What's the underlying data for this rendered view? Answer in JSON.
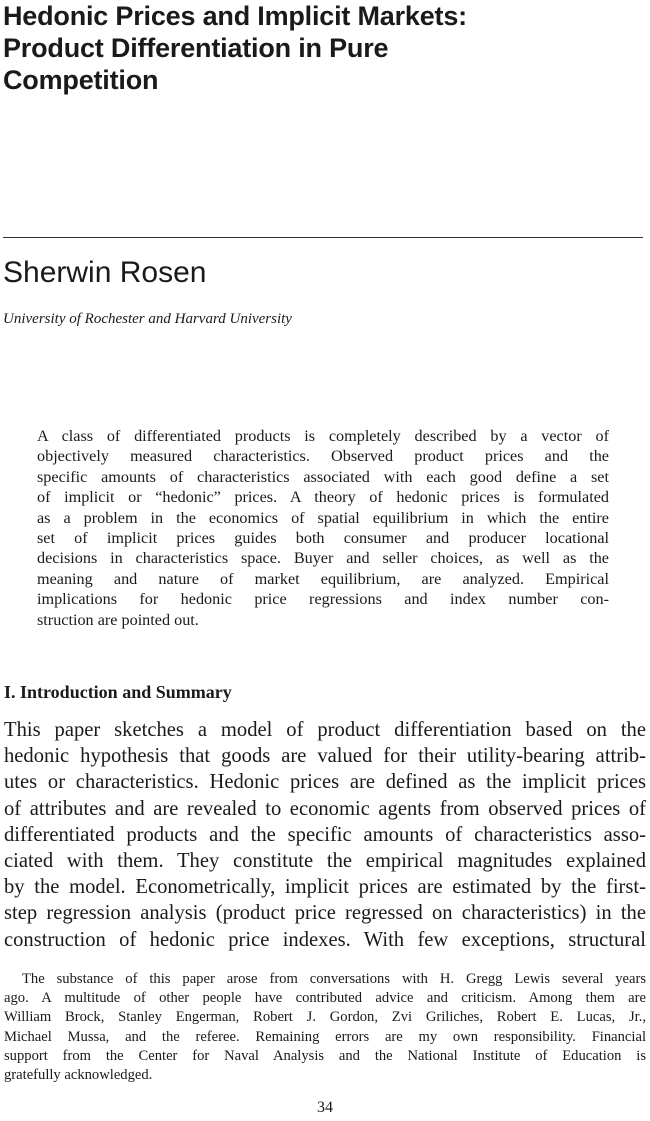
{
  "article": {
    "title_lines": [
      "Hedonic Prices and Implicit Markets:",
      "Product Differentiation in Pure",
      "Competition"
    ],
    "author": "Sherwin Rosen",
    "affiliation": "University of Rochester and Harvard University"
  },
  "abstract": {
    "lines": [
      "A class of differentiated products is completely described by a vector of",
      "objectively measured characteristics. Observed product prices and the",
      "specific amounts of characteristics associated with each good define a set",
      "of implicit or “hedonic” prices. A theory of hedonic prices is formulated",
      "as a problem in the economics of spatial equilibrium in which the entire",
      "set of implicit prices guides both consumer and producer locational",
      "decisions in characteristics space. Buyer and seller choices, as well as the",
      "meaning and nature of market equilibrium, are analyzed. Empirical",
      "implications for hedonic price regressions and index number con-",
      "struction are pointed out."
    ]
  },
  "section": {
    "heading": "I. Introduction and Summary",
    "lines": [
      "This paper sketches a model of product differentiation based on the",
      "hedonic hypothesis that goods are valued for their utility-bearing attrib-",
      "utes or characteristics. Hedonic prices are defined as the implicit prices",
      "of attributes and are revealed to economic agents from observed prices of",
      "differentiated products and the specific amounts of characteristics asso-",
      "ciated with them. They constitute the empirical magnitudes explained",
      "by the model. Econometrically, implicit prices are estimated by the first-",
      "step regression analysis (product price regressed on characteristics) in the",
      "construction of hedonic price indexes. With few exceptions, structural"
    ]
  },
  "footnote": {
    "lines": [
      "The substance of this paper arose from conversations with H. Gregg Lewis several years",
      "ago. A multitude of other people have contributed advice and criticism. Among them are",
      "William Brock, Stanley Engerman, Robert J. Gordon, Zvi Griliches, Robert E. Lucas, Jr.,",
      "Michael Mussa, and the referee. Remaining errors are my own responsibility. Financial",
      "support from the Center for Naval Analysis and the National Institute of Education is",
      "gratefully acknowledged."
    ]
  },
  "page_number": "34"
}
